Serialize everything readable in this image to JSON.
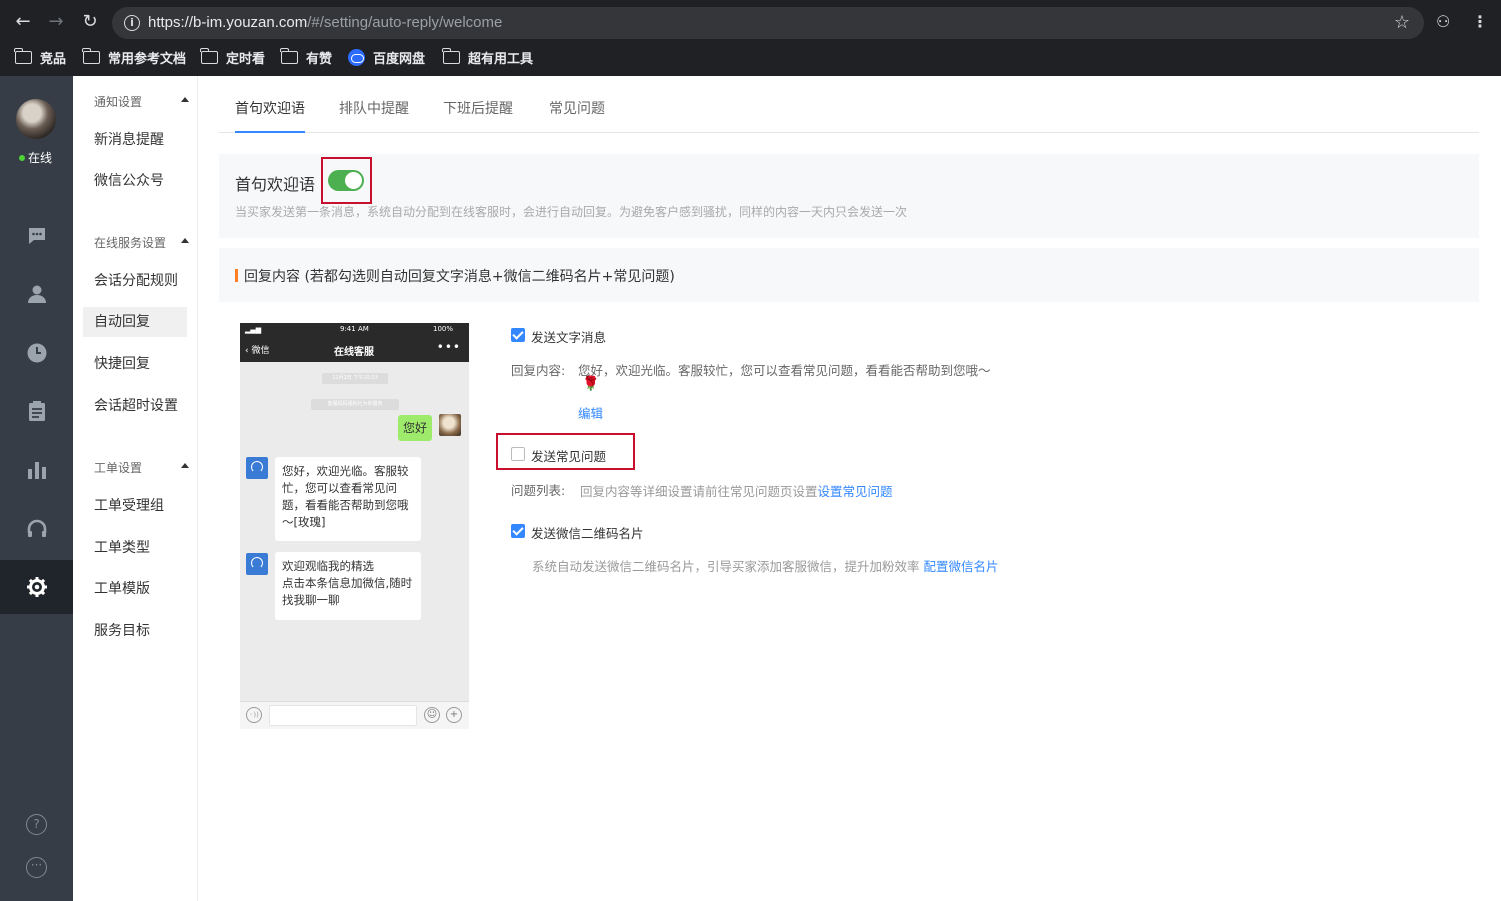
{
  "browser": {
    "url_host": "https://b-im.youzan.com",
    "url_path": "/#/setting/auto-reply/welcome",
    "bookmarks": [
      "竞品",
      "常用参考文档",
      "定时看",
      "有赞",
      "百度网盘",
      "超有用工具"
    ]
  },
  "rail": {
    "status": "在线",
    "icons": [
      "chat-icon",
      "user-icon",
      "clock-icon",
      "clipboard-icon",
      "chart-icon",
      "headset-icon",
      "gear-icon"
    ]
  },
  "menu": {
    "groups": [
      {
        "title": "通知设置",
        "items": [
          "新消息提醒",
          "微信公众号"
        ]
      },
      {
        "title": "在线服务设置",
        "items": [
          "会话分配规则",
          "自动回复",
          "快捷回复",
          "会话超时设置"
        ]
      },
      {
        "title": "工单设置",
        "items": [
          "工单受理组",
          "工单类型",
          "工单模版",
          "服务目标"
        ]
      }
    ]
  },
  "tabs": [
    "首句欢迎语",
    "排队中提醒",
    "下班后提醒",
    "常见问题"
  ],
  "welcome": {
    "title": "首句欢迎语",
    "enabled": true,
    "desc": "当买家发送第一条消息，系统自动分配到在线客服时，会进行自动回复。为避免客户感到骚扰，同样的内容一天内只会发送一次"
  },
  "reply_section": {
    "title": "回复内容  (若都勾选则自动回复文字消息+微信二维码名片+常见问题)"
  },
  "phone": {
    "time": "9:41 AM",
    "battery": "100%",
    "back": "微信",
    "title": "在线客服",
    "more": "•••",
    "time_pill": "11月2日 下午10:23",
    "notice": "客服妈妈福利社为你服务",
    "me_msg": "您好",
    "cs_msg1": "您好，欢迎光临。客服较忙，您可以查看常见问题，看看能否帮助到您哦～[玫瑰]",
    "cs_msg2": "欢迎观临我的精选\n点击本条信息加微信,随时找我聊一聊"
  },
  "options": {
    "text_msg": {
      "label": "发送文字消息",
      "checked": true,
      "content_label": "回复内容:",
      "content": "您好，欢迎光临。客服较忙，您可以查看常见问题，看看能否帮助到您哦～",
      "emoji": "🌹",
      "edit": "编辑"
    },
    "faq": {
      "label": "发送常见问题",
      "checked": false,
      "list_label": "问题列表:",
      "hint": "回复内容等详细设置请前往常见问题页设置",
      "link": "设置常见问题"
    },
    "wechat_card": {
      "label": "发送微信二维码名片",
      "checked": true,
      "desc": "系统自动发送微信二维码名片，引导买家添加客服微信，提升加粉效率",
      "link": "配置微信名片"
    }
  }
}
